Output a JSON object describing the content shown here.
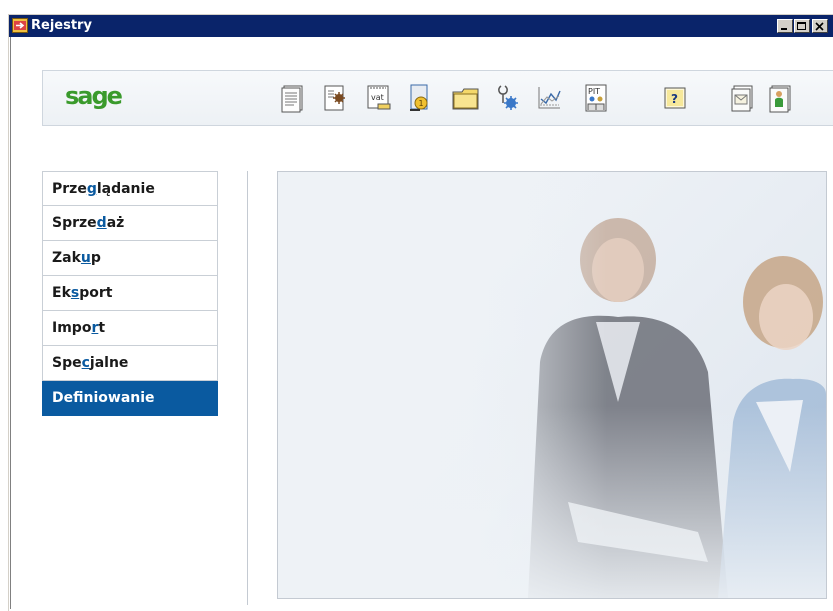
{
  "window": {
    "title": "Rejestry"
  },
  "toolbar": {
    "logo": "sage",
    "tools": [
      {
        "icon": "document-list-icon"
      },
      {
        "icon": "document-gear-icon"
      },
      {
        "icon": "vat-icon",
        "text": "vat"
      },
      {
        "icon": "document-coin-icon"
      },
      {
        "icon": "folder-icon"
      },
      {
        "icon": "tools-gear-icon"
      },
      {
        "icon": "chart-icon"
      },
      {
        "icon": "pit-icon",
        "text": "PIT"
      },
      {
        "icon": "help-icon",
        "text": "?"
      },
      {
        "icon": "mail-icon"
      },
      {
        "icon": "user-book-icon"
      }
    ]
  },
  "nav": {
    "items": [
      {
        "pre": "Prze",
        "ul": "g",
        "post": "lądanie",
        "active": false
      },
      {
        "pre": "Sprze",
        "ul": "d",
        "post": "aż",
        "active": false
      },
      {
        "pre": "Zak",
        "ul": "u",
        "post": "p",
        "active": false
      },
      {
        "pre": "Ek",
        "ul": "s",
        "post": "port",
        "active": false
      },
      {
        "pre": "Impo",
        "ul": "r",
        "post": "t",
        "active": false
      },
      {
        "pre": "Spe",
        "ul": "c",
        "post": "jalne",
        "active": false
      },
      {
        "pre": "Def",
        "ul": "i",
        "post": "niowanie",
        "active": true
      }
    ]
  },
  "colors": {
    "titlebar": "#0a246a",
    "accent": "#0a5aa0",
    "logo": "#3a9a2c"
  }
}
